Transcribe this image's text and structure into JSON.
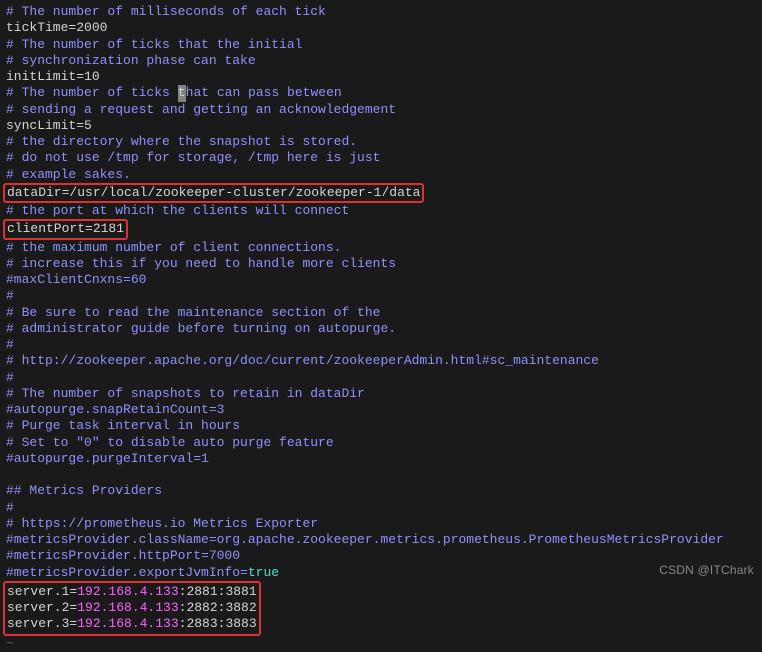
{
  "lines": {
    "l1": "# The number of milliseconds of each tick",
    "l2": "tickTime=2000",
    "l3": "# The number of ticks that the initial",
    "l4": "# synchronization phase can take",
    "l5": "initLimit=10",
    "l6_pre": "# The number of ticks ",
    "l6_cur": "t",
    "l6_post": "hat can pass between",
    "l7": "# sending a request and getting an acknowledgement",
    "l8": "syncLimit=5",
    "l9": "# the directory where the snapshot is stored.",
    "l10": "# do not use /tmp for storage, /tmp here is just",
    "l11": "# example sakes.",
    "l12": "dataDir=/usr/local/zookeeper-cluster/zookeeper-1/data",
    "l13": "# the port at which the clients will connect",
    "l14": "clientPort=2181",
    "l15": "# the maximum number of client connections.",
    "l16": "# increase this if you need to handle more clients",
    "l17": "#maxClientCnxns=60",
    "l18": "#",
    "l19": "# Be sure to read the maintenance section of the",
    "l20": "# administrator guide before turning on autopurge.",
    "l21": "#",
    "l22": "# http://zookeeper.apache.org/doc/current/zookeeperAdmin.html#sc_maintenance",
    "l23": "#",
    "l24": "# The number of snapshots to retain in dataDir",
    "l25": "#autopurge.snapRetainCount=3",
    "l26": "# Purge task interval in hours",
    "l27": "# Set to \"0\" to disable auto purge feature",
    "l28": "#autopurge.purgeInterval=1",
    "l29": "",
    "l30": "## Metrics Providers",
    "l31": "#",
    "l32": "# https://prometheus.io Metrics Exporter",
    "l33": "#metricsProvider.className=org.apache.zookeeper.metrics.prometheus.PrometheusMetricsProvider",
    "l34": "#metricsProvider.httpPort=7000",
    "l35_pre": "#metricsProvider.exportJvmInfo=",
    "l35_val": "true",
    "s1_pre": "server.1=",
    "s1_ip": "192.168.4.133",
    "s1_post": ":2881:3881",
    "s2_pre": "server.2=",
    "s2_ip": "192.168.4.133",
    "s2_post": ":2882:3882",
    "s3_pre": "server.3=",
    "s3_ip": "192.168.4.133",
    "s3_post": ":2883:3883",
    "tilde": "~"
  },
  "watermark": "CSDN @ITChark"
}
